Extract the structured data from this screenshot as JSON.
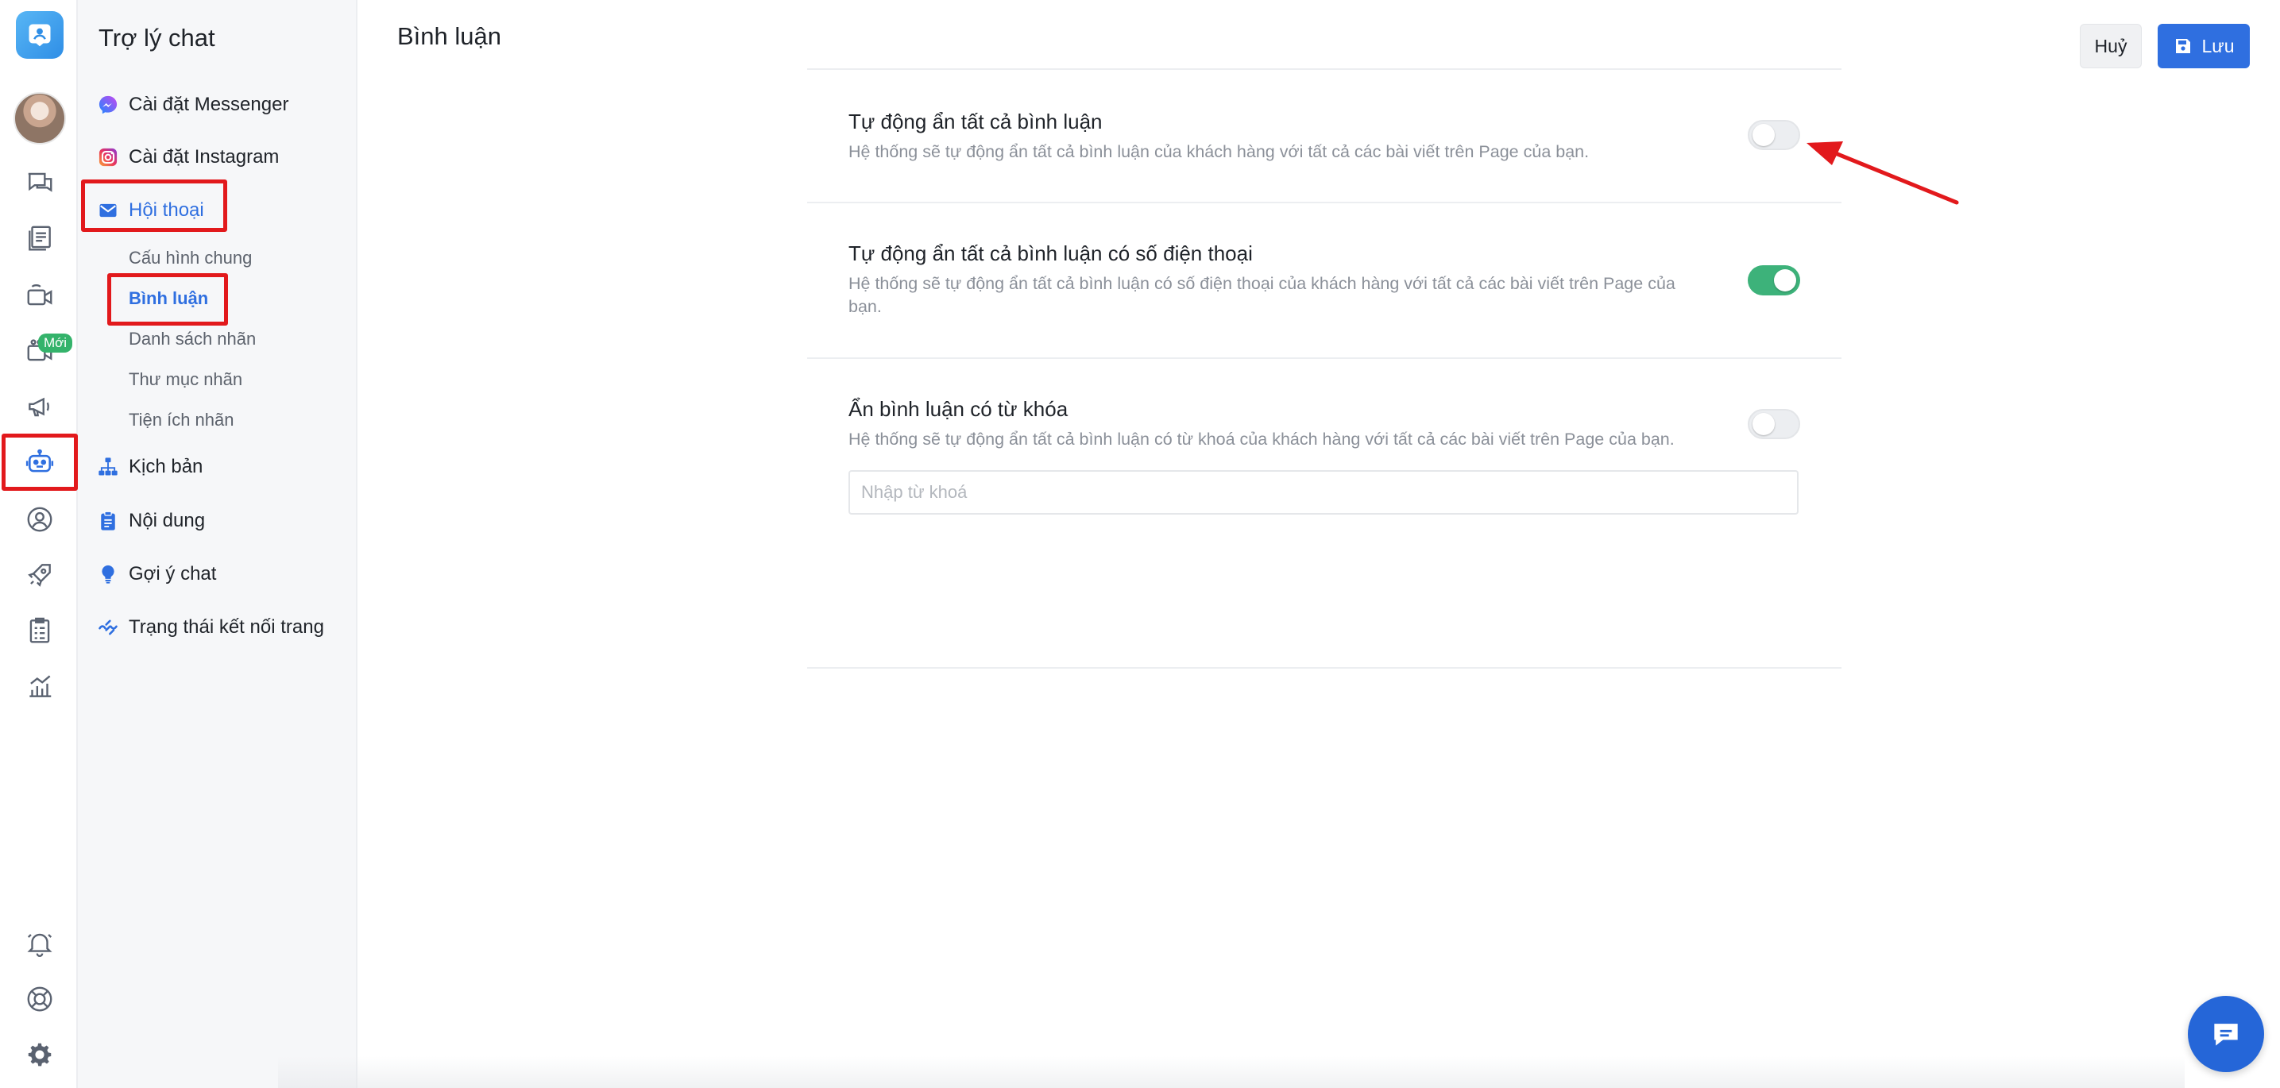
{
  "sidebar": {
    "title": "Trợ lý chat",
    "items": [
      {
        "label": "Cài đặt Messenger"
      },
      {
        "label": "Cài đặt Instagram"
      },
      {
        "label": "Hội thoại"
      },
      {
        "label": "Kịch bản"
      },
      {
        "label": "Nội dung"
      },
      {
        "label": "Gợi ý chat"
      },
      {
        "label": "Trạng thái kết nối trang"
      }
    ],
    "subitems": [
      {
        "label": "Cấu hình chung"
      },
      {
        "label": "Bình luận"
      },
      {
        "label": "Danh sách nhãn"
      },
      {
        "label": "Thư mục nhãn"
      },
      {
        "label": "Tiện ích nhãn"
      }
    ]
  },
  "rail": {
    "new_badge": "Mới"
  },
  "header": {
    "title": "Bình luận",
    "cancel_label": "Huỷ",
    "save_label": "Lưu"
  },
  "settings": [
    {
      "title": "Tự động ẩn tất cả bình luận",
      "description": "Hệ thống sẽ tự động ẩn tất cả bình luận của khách hàng với tất cả các bài viết trên Page của bạn.",
      "enabled": false
    },
    {
      "title": "Tự động ẩn tất cả bình luận có số điện thoại",
      "description": "Hệ thống sẽ tự động ẩn tất cả bình luận có số điện thoại của khách hàng với tất cả các bài viết trên Page của bạn.",
      "enabled": true
    },
    {
      "title": "Ẩn bình luận có từ khóa",
      "description": "Hệ thống sẽ tự động ẩn tất cả bình luận có từ khoá của khách hàng với tất cả các bài viết trên Page của bạn.",
      "enabled": false,
      "keyword_placeholder": "Nhập từ khoá"
    }
  ],
  "colors": {
    "accent": "#2f6fe0",
    "toggle_on": "#3db27a",
    "highlight": "#e2191c"
  }
}
